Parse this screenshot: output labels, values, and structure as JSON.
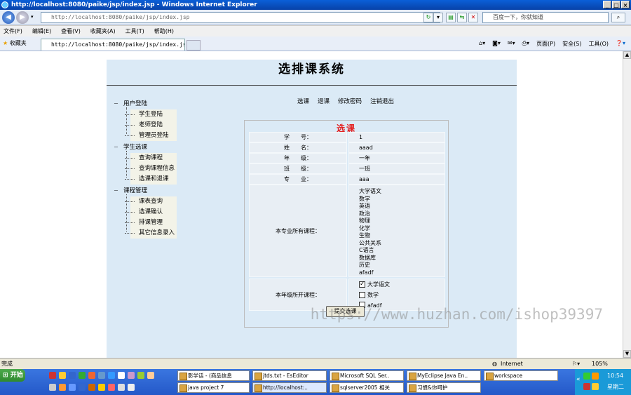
{
  "window": {
    "title": "http://localhost:8080/paike/jsp/index.jsp - Windows Internet Explorer",
    "controls": [
      "_",
      "□",
      "×"
    ]
  },
  "address_bar": {
    "url": "http://localhost:8080/paike/jsp/index.jsp",
    "search_placeholder": "百度一下，你就知道"
  },
  "menu": [
    "文件(F)",
    "编辑(E)",
    "查看(V)",
    "收藏夹(A)",
    "工具(T)",
    "帮助(H)"
  ],
  "favorites_label": "收藏夹",
  "tab": {
    "title": "http://localhost:8080/paike/jsp/index.jsp"
  },
  "right_tools": {
    "page": "页面(P)",
    "safety": "安全(S)",
    "tools": "工具(O)"
  },
  "page": {
    "title": "选排课系统",
    "top_links": [
      "选课",
      "退课",
      "修改密码",
      "注销退出"
    ],
    "tree": [
      {
        "label": "用户登陆",
        "items": [
          "学生登陆",
          "老师登陆",
          "管理员登陆"
        ]
      },
      {
        "label": "学生选课",
        "items": [
          "查询课程",
          "查询课程信息",
          "选课和退课"
        ]
      },
      {
        "label": "课程管理",
        "items": [
          "课表查询",
          "选课确认",
          "排课管理",
          "其它信息录入"
        ]
      }
    ],
    "form": {
      "title": "选课",
      "fields": [
        {
          "label": "学　　号：",
          "value": "1"
        },
        {
          "label": "姓　　名：",
          "value": "aaad"
        },
        {
          "label": "年　　级：",
          "value": "一年"
        },
        {
          "label": "班　　级：",
          "value": "一班"
        },
        {
          "label": "专　　业：",
          "value": "aaa"
        }
      ],
      "major_courses_label": "本专业所有课程：",
      "major_courses": [
        "大学语文",
        "数学",
        "英语",
        "政治",
        "物理",
        "化学",
        "生物",
        "公共关系",
        "C语言",
        "数据库",
        "历史",
        "afadf"
      ],
      "grade_courses_label": "本年级所开课程：",
      "grade_courses": [
        {
          "name": "大学语文",
          "checked": true
        },
        {
          "name": "数学",
          "checked": false
        },
        {
          "name": "afadf",
          "checked": false
        }
      ],
      "submit_label": "提交选课"
    }
  },
  "status": {
    "left": "完成",
    "zone": "Internet",
    "zoom": "105%"
  },
  "watermark": "https://www.huzhan.com/ishop39397",
  "taskbar": {
    "start": "开始",
    "row1": [
      "影学话 - (商品信息",
      "jtds.txt - EsEditor",
      "Microsoft SQL Ser..",
      "MyEclipse Java En..",
      "workspace"
    ],
    "row2": [
      "java project 7",
      "http://localhost:..",
      "sqlserver2005 相关",
      "习惯&你呵护"
    ],
    "time": "10:54",
    "day": "星期二"
  }
}
